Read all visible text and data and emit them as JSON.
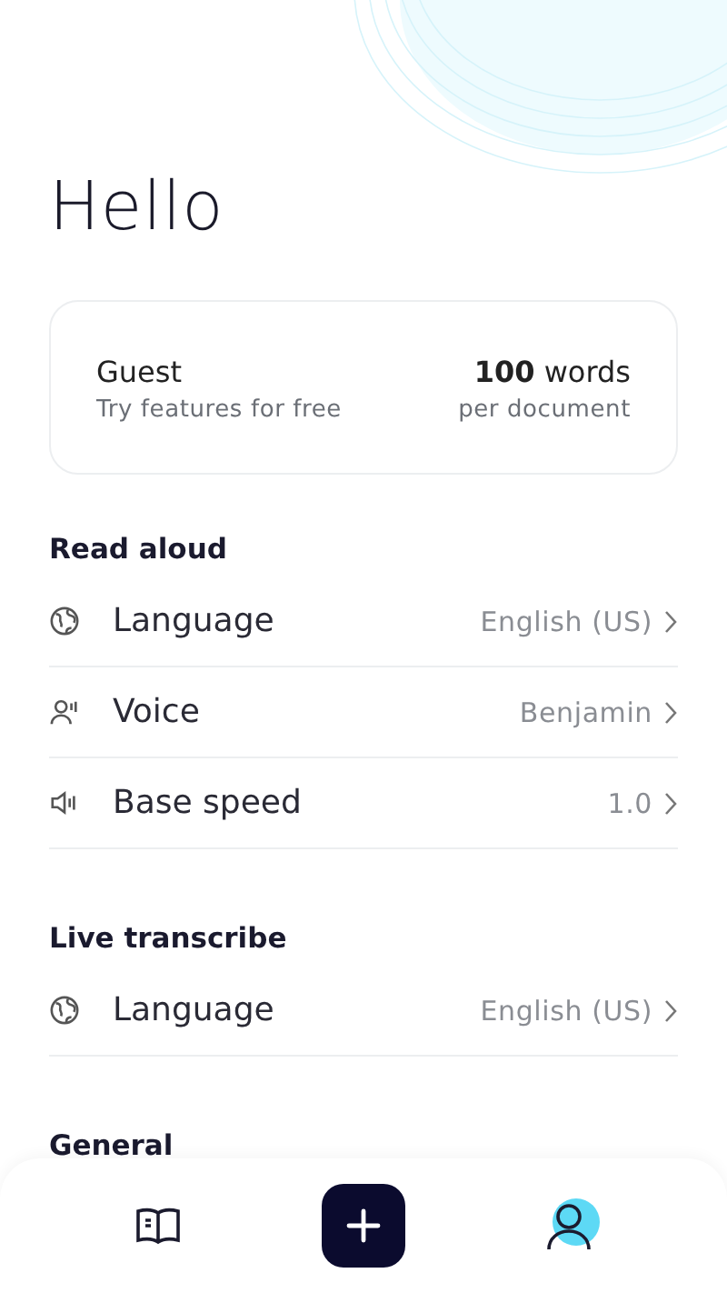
{
  "title": "Hello",
  "plan": {
    "name": "Guest",
    "subtitle": "Try features for free",
    "amount": "100",
    "unit": "words",
    "per": "per document"
  },
  "sections": [
    {
      "heading": "Read aloud",
      "rows": [
        {
          "kind": "globe",
          "label": "Language",
          "value": "English (US)"
        },
        {
          "kind": "voice",
          "label": "Voice",
          "value": "Benjamin"
        },
        {
          "kind": "speaker",
          "label": "Base speed",
          "value": "1.0"
        }
      ]
    },
    {
      "heading": "Live transcribe",
      "rows": [
        {
          "kind": "globe",
          "label": "Language",
          "value": "English (US)"
        }
      ]
    },
    {
      "heading": "General"
    }
  ],
  "nav": [
    {
      "kind": "book",
      "selected": false
    },
    {
      "kind": "add",
      "selected": false
    },
    {
      "kind": "profile",
      "selected": true
    }
  ]
}
